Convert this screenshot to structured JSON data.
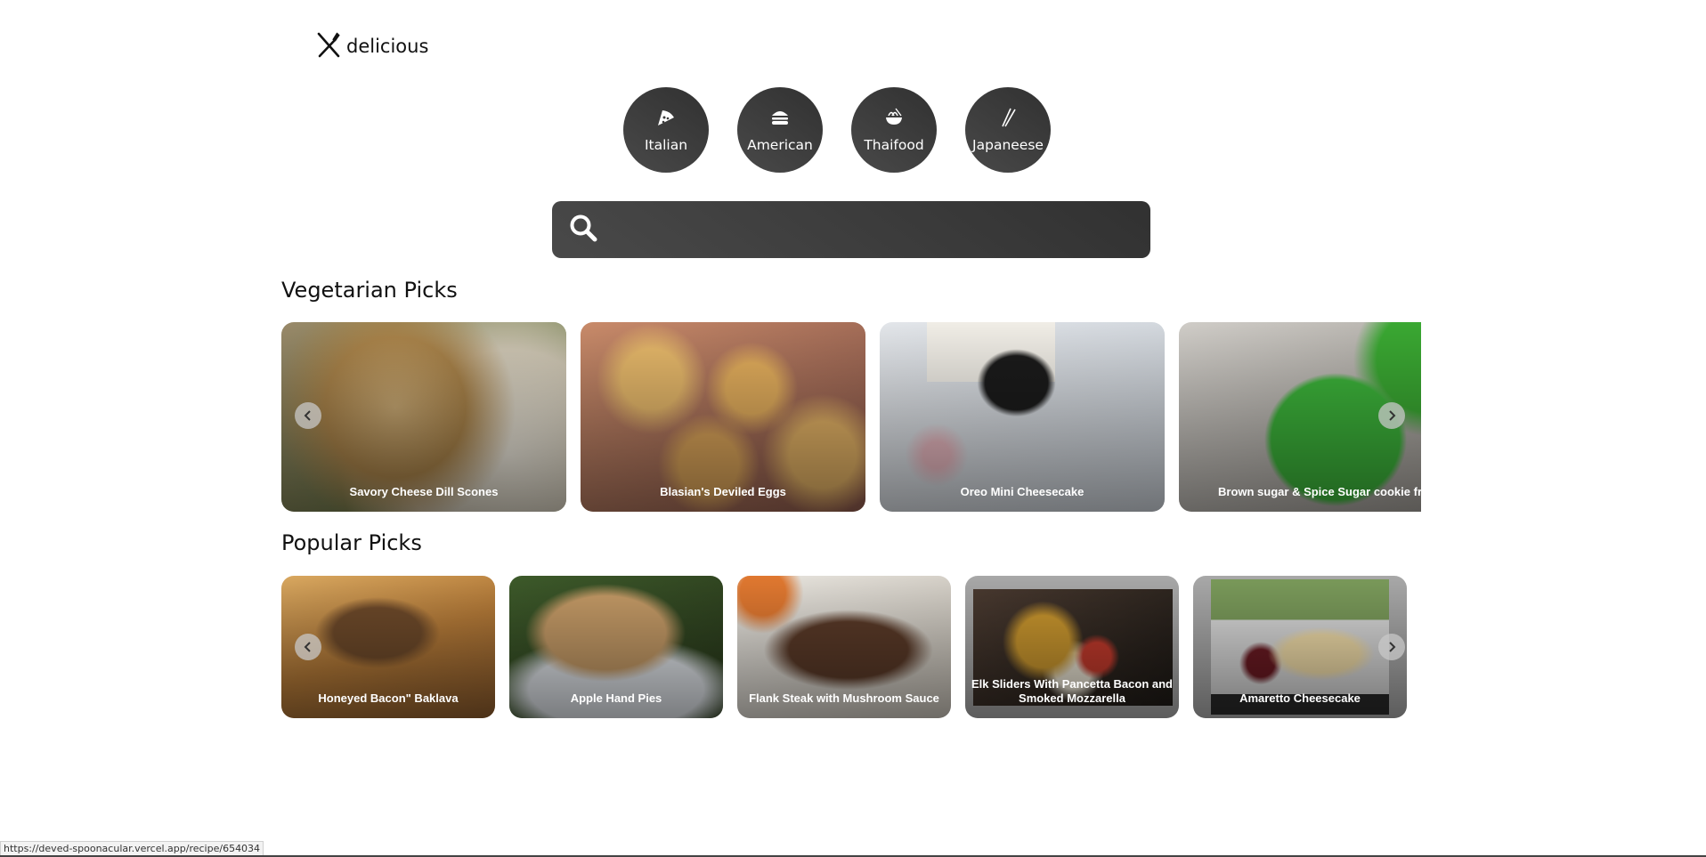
{
  "logo": {
    "text": "delicious"
  },
  "categories": [
    {
      "label": "Italian",
      "icon": "pizza-icon"
    },
    {
      "label": "American",
      "icon": "burger-icon"
    },
    {
      "label": "Thaifood",
      "icon": "noodle-bowl-icon"
    },
    {
      "label": "Japaneese",
      "icon": "chopsticks-icon"
    }
  ],
  "search": {
    "value": "",
    "placeholder": ""
  },
  "veggie": {
    "heading": "Vegetarian Picks",
    "cards": [
      {
        "title": "Savory Cheese Dill Scones"
      },
      {
        "title": "Blasian's Deviled Eggs"
      },
      {
        "title": "Oreo Mini Cheesecake"
      },
      {
        "title": "Brown sugar & Spice Sugar cookie frog"
      }
    ]
  },
  "popular": {
    "heading": "Popular Picks",
    "cards": [
      {
        "title": "Honeyed Bacon\" Baklava"
      },
      {
        "title": "Apple Hand Pies"
      },
      {
        "title": "Flank Steak with Mushroom Sauce"
      },
      {
        "title": "Elk Sliders With Pancetta Bacon and Smoked Mozzarella"
      },
      {
        "title": "Amaretto Cheesecake"
      }
    ]
  },
  "status_url": "https://deved-spoonacular.vercel.app/recipe/654034"
}
